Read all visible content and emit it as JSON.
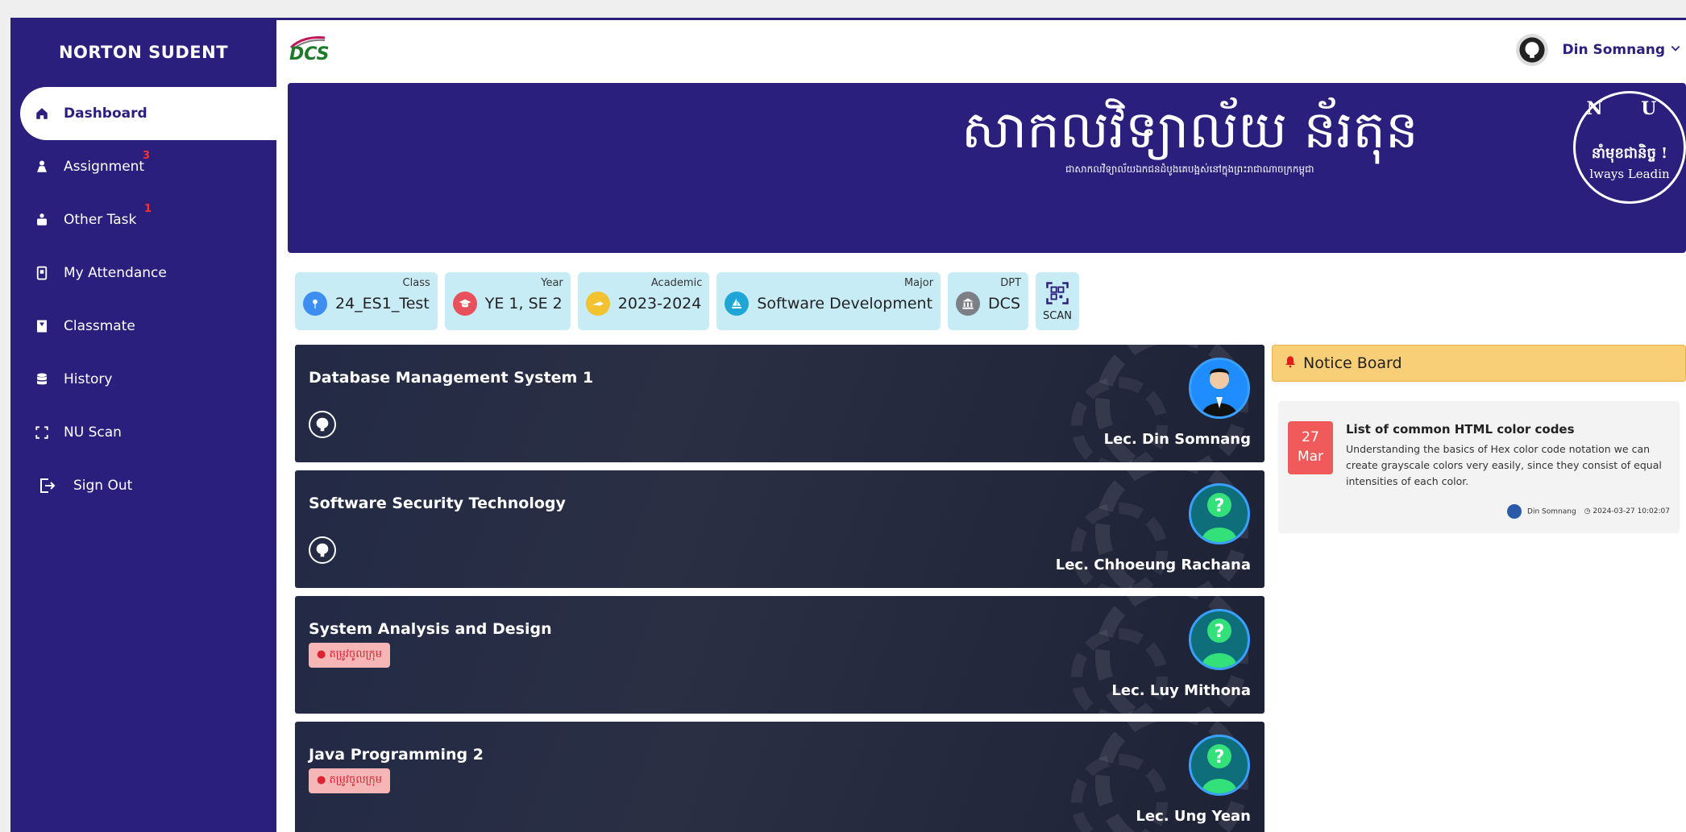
{
  "sidebar": {
    "brand": "NORTON SUDENT",
    "items": [
      {
        "label": "Dashboard",
        "icon": "home-icon",
        "active": true
      },
      {
        "label": "Assignment",
        "icon": "assignment-icon",
        "badge": "3"
      },
      {
        "label": "Other Task",
        "icon": "task-icon",
        "badge": "1"
      },
      {
        "label": "My Attendance",
        "icon": "attendance-icon"
      },
      {
        "label": "Classmate",
        "icon": "classmate-icon"
      },
      {
        "label": "History",
        "icon": "database-icon"
      },
      {
        "label": "NU Scan",
        "icon": "scan-icon"
      },
      {
        "label": "Sign Out",
        "icon": "sign-out-icon"
      }
    ]
  },
  "topbar": {
    "logo_text": "DCS",
    "user_name": "Din Somnang"
  },
  "banner": {
    "title": "សាកលវិទ្យាល័យ ន័រតុន",
    "subtitle": "ជាសាកលវិទ្យាល័យឯកជនដំបូងគេបង្អស់នៅក្នុងព្រះរាជាណាចក្រកម្ពុជា",
    "seal_top": "N U",
    "seal_khmer": "នាំមុខជានិច្ច !",
    "seal_english": "lways Leadin"
  },
  "chips": [
    {
      "caption": "Class",
      "value": "24_ES1_Test",
      "color": "#3d8ef0"
    },
    {
      "caption": "Year",
      "value": "YE 1, SE 2",
      "color": "#e8505b"
    },
    {
      "caption": "Academic",
      "value": "2023-2024",
      "color": "#f2c230"
    },
    {
      "caption": "Major",
      "value": "Software Development",
      "color": "#1fa6d6"
    },
    {
      "caption": "DPT",
      "value": "DCS",
      "color": "#7c7f86"
    }
  ],
  "scan": {
    "label": "SCAN"
  },
  "courses": [
    {
      "title": "Database Management System 1",
      "lecturer": "Lec. Din Somnang"
    },
    {
      "title": "Software Security Technology",
      "lecturer": "Lec. Chhoeung Rachana"
    },
    {
      "title": "System Analysis and Design",
      "lecturer": "Lec. Luy Mithona",
      "tag": "តម្រូវចូលក្រុម"
    },
    {
      "title": "Java Programming 2",
      "lecturer": "Lec. Ung Yean",
      "tag": "តម្រូវចូលក្រុម"
    }
  ],
  "notice": {
    "heading": "Notice Board",
    "day": "27",
    "month": "Mar",
    "title": "List of common HTML color codes",
    "text": "Understanding the basics of Hex color code notation we can create grayscale colors very easily, since they consist of equal intensities of each color.",
    "author": "Din Somnang",
    "timestamp": "2024-03-27 10:02:07"
  },
  "colors": {
    "primary": "#2a1f7d",
    "chip_bg": "#c8ecf6",
    "notice_head": "#f8cf77",
    "date_box": "#f05a5a",
    "badge": "#ff3030"
  }
}
